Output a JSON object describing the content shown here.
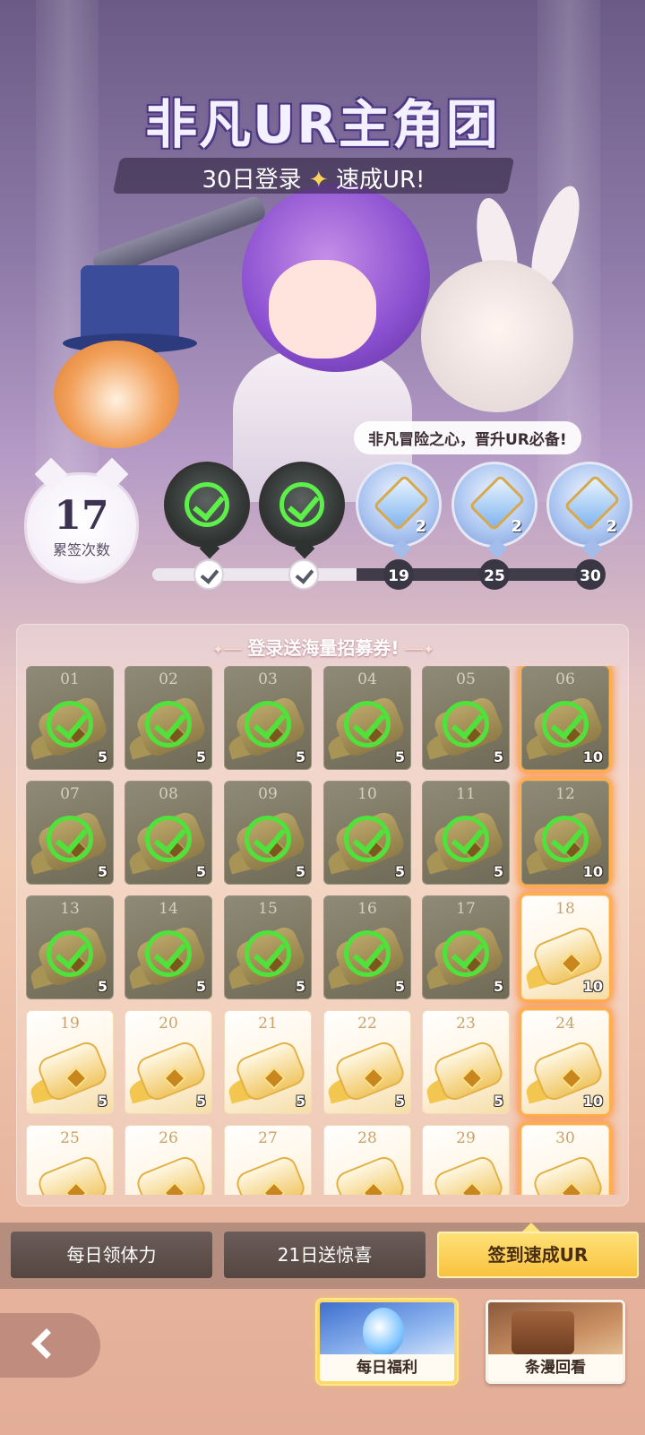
{
  "banner": {
    "title": "非凡UR主角团",
    "subtitle_left": "30日登录",
    "subtitle_right": "速成UR!",
    "tagline": "非凡冒险之心，晋升UR必备!"
  },
  "counter": {
    "value": "17",
    "label": "累签次数"
  },
  "milestones": [
    {
      "state": "claimed",
      "qty": "",
      "icon": "check-icon"
    },
    {
      "state": "claimed",
      "qty": "",
      "icon": "check-icon"
    },
    {
      "state": "locked",
      "qty": "2",
      "icon": "crystal-icon"
    },
    {
      "state": "locked",
      "qty": "2",
      "icon": "crystal-icon"
    },
    {
      "state": "locked",
      "qty": "2",
      "icon": "crystal-icon"
    }
  ],
  "progress_nodes": [
    {
      "label": "",
      "state": "done"
    },
    {
      "label": "",
      "state": "done"
    },
    {
      "label": "19",
      "state": "todo"
    },
    {
      "label": "25",
      "state": "todo"
    },
    {
      "label": "30",
      "state": "todo"
    }
  ],
  "grid": {
    "title": "登录送海量招募券!",
    "days": [
      {
        "day": "01",
        "qty": "5",
        "claimed": true,
        "big": false
      },
      {
        "day": "02",
        "qty": "5",
        "claimed": true,
        "big": false
      },
      {
        "day": "03",
        "qty": "5",
        "claimed": true,
        "big": false
      },
      {
        "day": "04",
        "qty": "5",
        "claimed": true,
        "big": false
      },
      {
        "day": "05",
        "qty": "5",
        "claimed": true,
        "big": false
      },
      {
        "day": "06",
        "qty": "10",
        "claimed": true,
        "big": true
      },
      {
        "day": "07",
        "qty": "5",
        "claimed": true,
        "big": false
      },
      {
        "day": "08",
        "qty": "5",
        "claimed": true,
        "big": false
      },
      {
        "day": "09",
        "qty": "5",
        "claimed": true,
        "big": false
      },
      {
        "day": "10",
        "qty": "5",
        "claimed": true,
        "big": false
      },
      {
        "day": "11",
        "qty": "5",
        "claimed": true,
        "big": false
      },
      {
        "day": "12",
        "qty": "10",
        "claimed": true,
        "big": true
      },
      {
        "day": "13",
        "qty": "5",
        "claimed": true,
        "big": false
      },
      {
        "day": "14",
        "qty": "5",
        "claimed": true,
        "big": false
      },
      {
        "day": "15",
        "qty": "5",
        "claimed": true,
        "big": false
      },
      {
        "day": "16",
        "qty": "5",
        "claimed": true,
        "big": false
      },
      {
        "day": "17",
        "qty": "5",
        "claimed": true,
        "big": false
      },
      {
        "day": "18",
        "qty": "10",
        "claimed": false,
        "big": true
      },
      {
        "day": "19",
        "qty": "5",
        "claimed": false,
        "big": false
      },
      {
        "day": "20",
        "qty": "5",
        "claimed": false,
        "big": false
      },
      {
        "day": "21",
        "qty": "5",
        "claimed": false,
        "big": false
      },
      {
        "day": "22",
        "qty": "5",
        "claimed": false,
        "big": false
      },
      {
        "day": "23",
        "qty": "5",
        "claimed": false,
        "big": false
      },
      {
        "day": "24",
        "qty": "10",
        "claimed": false,
        "big": true
      },
      {
        "day": "25",
        "qty": "",
        "claimed": false,
        "big": false
      },
      {
        "day": "26",
        "qty": "",
        "claimed": false,
        "big": false
      },
      {
        "day": "27",
        "qty": "",
        "claimed": false,
        "big": false
      },
      {
        "day": "28",
        "qty": "",
        "claimed": false,
        "big": false
      },
      {
        "day": "29",
        "qty": "",
        "claimed": false,
        "big": false
      },
      {
        "day": "30",
        "qty": "",
        "claimed": false,
        "big": true
      }
    ]
  },
  "tabs": [
    {
      "label": "每日领体力",
      "active": false
    },
    {
      "label": "21日送惊喜",
      "active": false
    },
    {
      "label": "签到速成UR",
      "active": true
    }
  ],
  "bottom": {
    "daily_label": "每日福利",
    "comic_label": "条漫回看"
  },
  "colors": {
    "check_green": "#4fe23a",
    "active_tab": "#f8c13c",
    "glow_orange": "#ff8a3a"
  }
}
